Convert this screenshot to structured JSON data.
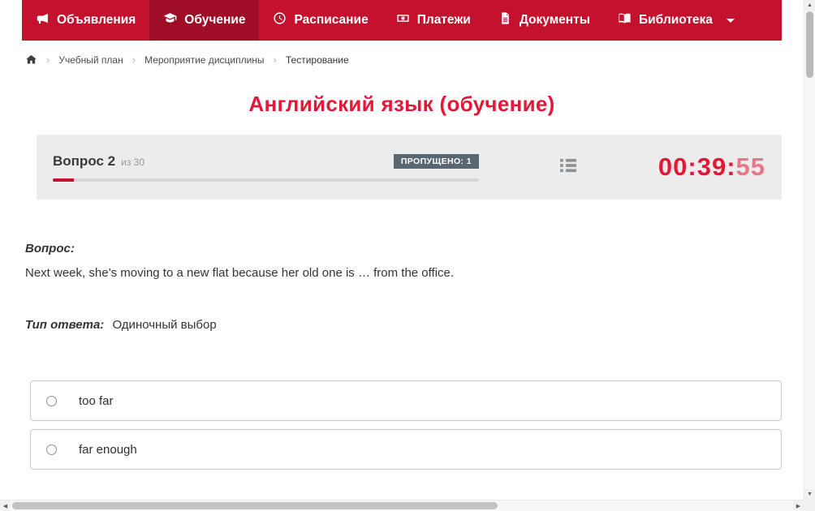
{
  "colors": {
    "nav_bg": "#c4112e",
    "nav_active_bg": "#a00d26",
    "accent_red": "#e31837",
    "badge_bg": "#5b6770",
    "card_bg": "#ececec"
  },
  "nav": {
    "items": [
      {
        "label": "Объявления",
        "icon": "megaphone-icon",
        "active": false
      },
      {
        "label": "Обучение",
        "icon": "graduation-cap-icon",
        "active": true
      },
      {
        "label": "Расписание",
        "icon": "clock-icon",
        "active": false
      },
      {
        "label": "Платежи",
        "icon": "banknote-icon",
        "active": false
      },
      {
        "label": "Документы",
        "icon": "document-icon",
        "active": false
      },
      {
        "label": "Библиотека",
        "icon": "book-icon",
        "active": false,
        "has_dropdown": true
      }
    ]
  },
  "breadcrumb": {
    "items": [
      {
        "label": "Учебный план"
      },
      {
        "label": "Мероприятие дисциплины"
      },
      {
        "label": "Тестирование"
      }
    ]
  },
  "page": {
    "title": "Английский язык (обучение)"
  },
  "question_panel": {
    "question_number_label": "Вопрос 2",
    "question_count_label": "из 30",
    "missed_badge": "ПРОПУЩЕНО: 1",
    "progress_percent": 5,
    "timer_main": "00:39:",
    "timer_seconds": "55"
  },
  "question": {
    "label": "Вопрос:",
    "text": "Next week, she’s moving to a new flat because her old one is … from the office.",
    "answer_type_label": "Тип ответа:",
    "answer_type_value": "Одиночный выбор"
  },
  "options": [
    {
      "label": "too far",
      "selected": false
    },
    {
      "label": "far enough",
      "selected": false
    }
  ],
  "icons": {
    "scroll_up": "▲",
    "scroll_down": "▼",
    "scroll_left": "◀",
    "scroll_right": "▶",
    "breadcrumb_separator": "›"
  }
}
